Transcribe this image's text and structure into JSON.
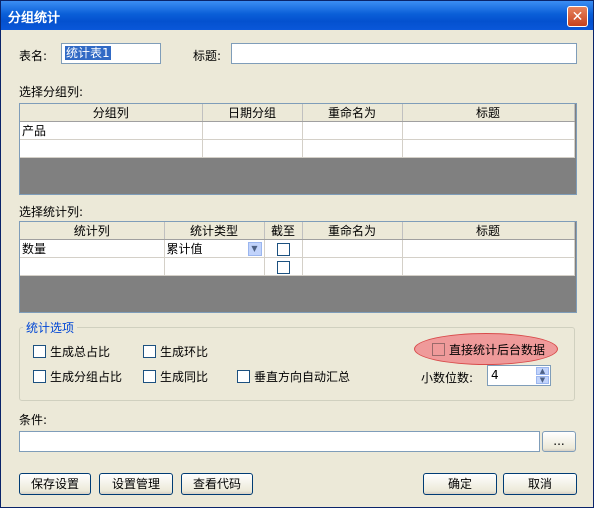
{
  "window": {
    "title": "分组统计",
    "close_icon": "close-icon"
  },
  "table_name": {
    "label": "表名:",
    "value": "统计表1"
  },
  "title_field": {
    "label": "标题:",
    "value": ""
  },
  "group_section": {
    "label": "选择分组列:",
    "columns": [
      "分组列",
      "日期分组",
      "重命名为",
      "标题"
    ],
    "rows": [
      [
        "产品",
        "",
        "",
        ""
      ],
      [
        "",
        "",
        "",
        ""
      ]
    ]
  },
  "stat_section": {
    "label": "选择统计列:",
    "columns": [
      "统计列",
      "统计类型",
      "截至",
      "重命名为",
      "标题"
    ],
    "rows": [
      {
        "col": "数量",
        "type": "累计值",
        "cutoff": false,
        "rename": "",
        "title": ""
      },
      {
        "col": "",
        "type": "",
        "cutoff": false,
        "rename": "",
        "title": ""
      }
    ]
  },
  "options": {
    "group_title": "统计选项",
    "total_ratio": "生成总占比",
    "chain_ratio": "生成环比",
    "group_ratio": "生成分组占比",
    "yoy_ratio": "生成同比",
    "vertical_sum": "垂直方向自动汇总",
    "direct_backend": "直接统计后台数据",
    "decimals_label": "小数位数:",
    "decimals_value": "4"
  },
  "condition": {
    "label": "条件:",
    "value": "",
    "browse": "..."
  },
  "buttons": {
    "save_settings": "保存设置",
    "manage_settings": "设置管理",
    "view_code": "查看代码",
    "ok": "确定",
    "cancel": "取消"
  }
}
